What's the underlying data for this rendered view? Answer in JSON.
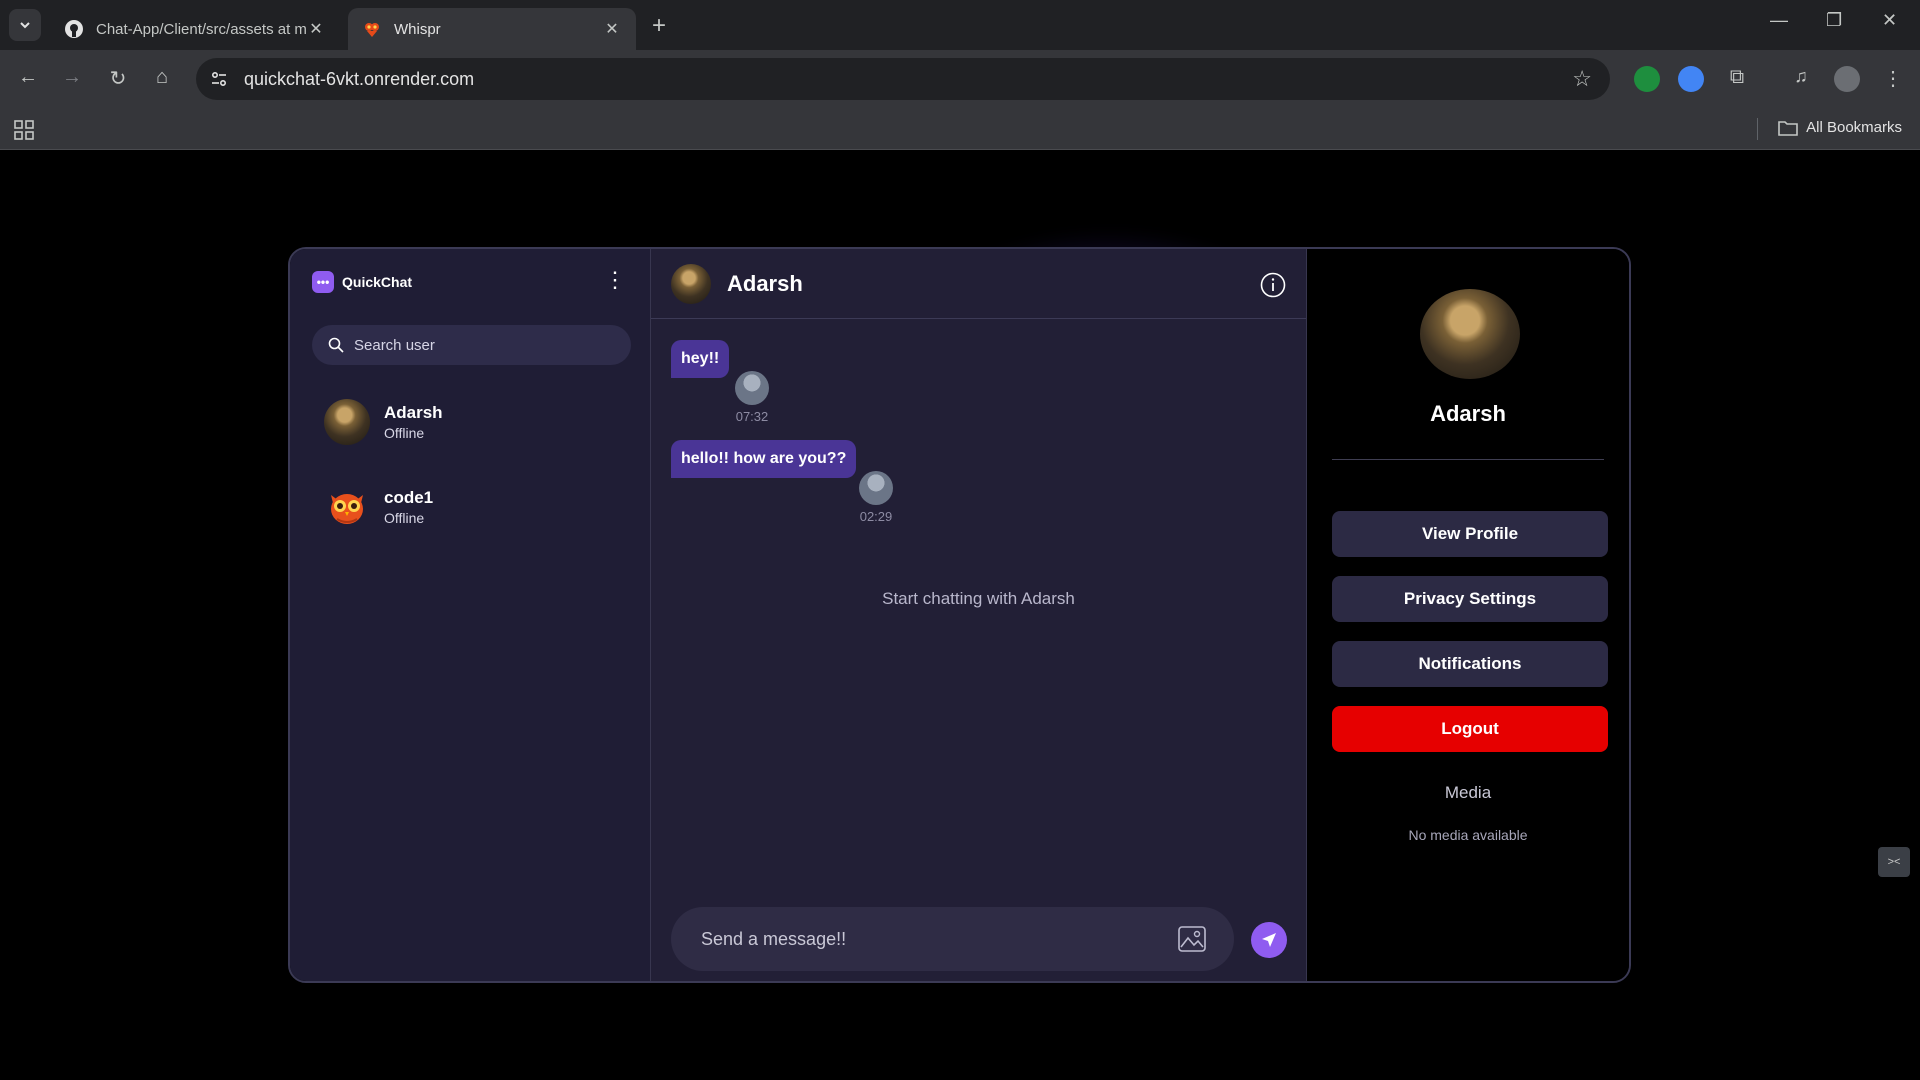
{
  "browser": {
    "tabs": [
      {
        "title": "Chat-App/Client/src/assets at m",
        "icon": "github-icon"
      },
      {
        "title": "Whispr",
        "icon": "site-favicon"
      }
    ],
    "url": "quickchat-6vkt.onrender.com",
    "bookmarks_label": "All Bookmarks"
  },
  "app": {
    "brand": "QuickChat",
    "search_placeholder": "Search user",
    "users": [
      {
        "name": "Adarsh",
        "status": "Offline"
      },
      {
        "name": "code1",
        "status": "Offline"
      }
    ],
    "chat": {
      "contact_name": "Adarsh",
      "messages": [
        {
          "text": "hey!!",
          "time": "07:32"
        },
        {
          "text": "hello!! how are you??",
          "time": "02:29"
        }
      ],
      "empty_note": "Start chatting with Adarsh",
      "composer_placeholder": "Send a message!!"
    },
    "profile": {
      "name": "Adarsh",
      "buttons": {
        "view_profile": "View Profile",
        "privacy": "Privacy Settings",
        "notifications": "Notifications",
        "logout": "Logout"
      },
      "media_title": "Media",
      "no_media": "No media available"
    }
  },
  "colors": {
    "accent": "#8f5cf0",
    "logout": "#e60000",
    "message_bubble": "#4a3596"
  }
}
